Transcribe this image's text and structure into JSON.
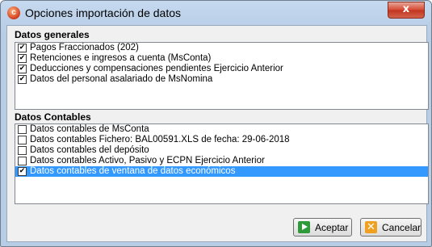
{
  "window": {
    "title": "Opciones importación de datos",
    "close_glyph": "x",
    "app_icon_glyph": "c"
  },
  "general": {
    "title": "Datos generales",
    "items": [
      {
        "label": "Pagos Fraccionados (202)",
        "checked": true
      },
      {
        "label": "Retenciones e ingresos a cuenta (MsConta)",
        "checked": true
      },
      {
        "label": "Deducciones y compensaciones pendientes Ejercicio Anterior",
        "checked": true
      },
      {
        "label": "Datos del personal asalariado de MsNomina",
        "checked": true
      }
    ]
  },
  "contables": {
    "title": "Datos Contables",
    "items": [
      {
        "label": "Datos contables de MsConta",
        "checked": false
      },
      {
        "label": "Datos contables Fichero: BAL00591.XLS de fecha: 29-06-2018",
        "checked": false
      },
      {
        "label": "Datos contables del depósito",
        "checked": false
      },
      {
        "label": "Datos contables Activo, Pasivo y ECPN Ejercicio Anterior",
        "checked": false
      },
      {
        "label": "Datos contables de ventana de datos económicos",
        "checked": true,
        "selected": true
      }
    ]
  },
  "buttons": {
    "accept": "Aceptar",
    "cancel": "Cancelar",
    "cancel_glyph": "✕"
  },
  "colors": {
    "selection": "#3399ff",
    "accept_icon": "#2e9a3a",
    "cancel_icon": "#f0a020",
    "close_button": "#c1341f"
  }
}
